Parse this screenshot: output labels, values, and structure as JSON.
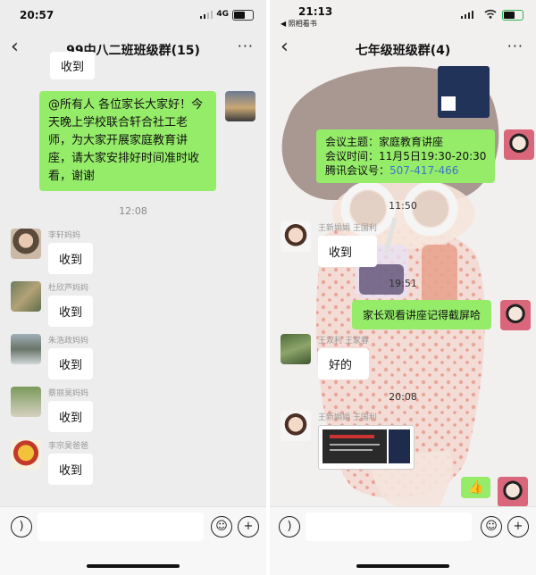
{
  "left": {
    "status": {
      "time": "20:57",
      "network": "4G"
    },
    "title": "99中八二班班级群(15)",
    "top_partial": "收到",
    "announcement": "@所有人 各位家长大家好！今天晚上学校联合轩合社工老师，为大家开展家庭教育讲座，请大家安排好时间准时收看，谢谢",
    "timestamp": "12:08",
    "messages": [
      {
        "sender": "李轩妈妈",
        "text": "收到"
      },
      {
        "sender": "杜欣芦妈妈",
        "text": "收到"
      },
      {
        "sender": "朱浩政妈妈",
        "text": "收到"
      },
      {
        "sender": "蔡丽昊妈妈",
        "text": "收到"
      },
      {
        "sender": "李宗昊爸爸",
        "text": "收到"
      }
    ]
  },
  "right": {
    "status": {
      "time": "21:13",
      "back_app": "◀ 照相看书"
    },
    "title": "七年级班级群(4)",
    "meeting": {
      "line1": "会议主题：家庭教育讲座",
      "line2": "会议时间：11月5日19:30-20:30",
      "line3_label": "腾讯会议号：",
      "line3_number": "507-417-466"
    },
    "times": [
      "11:50",
      "19:51",
      "20:08"
    ],
    "msg_received1": "收到",
    "msg_sent": "家长观看讲座记得截屏哈",
    "sender_b": "王双利 王家春",
    "msg_received2": "好的",
    "sender_a": "王新娟娟 王国利",
    "sender_c": "王新娟娟 王国利",
    "thumb_emoji": "👍"
  },
  "icons": {
    "back": "‹",
    "more": "···",
    "voice": "voice-icon",
    "emoji": "emoji-icon",
    "plus": "plus-icon"
  },
  "colors": {
    "green_bubble": "#95ec69",
    "link_blue": "#3b76c9"
  }
}
